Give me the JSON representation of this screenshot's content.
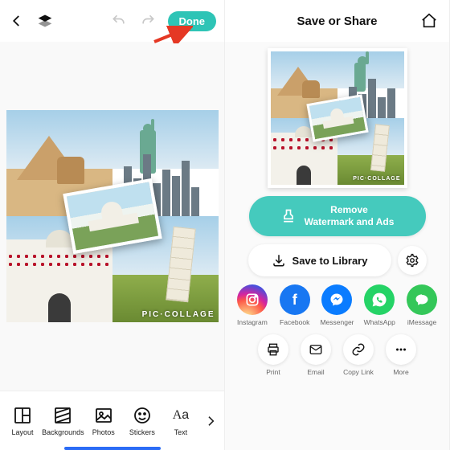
{
  "left": {
    "done_label": "Done",
    "watermark": "PIC·COLLAGE",
    "toolbar": [
      {
        "id": "layout",
        "label": "Layout"
      },
      {
        "id": "backgrounds",
        "label": "Backgrounds"
      },
      {
        "id": "photos",
        "label": "Photos"
      },
      {
        "id": "stickers",
        "label": "Stickers"
      },
      {
        "id": "text",
        "label": "Text"
      }
    ]
  },
  "right": {
    "title": "Save or Share",
    "remove_line1": "Remove",
    "remove_line2": "Watermark and Ads",
    "save_label": "Save to Library",
    "watermark": "PIC·COLLAGE",
    "share": [
      {
        "id": "instagram",
        "label": "Instagram"
      },
      {
        "id": "facebook",
        "label": "Facebook"
      },
      {
        "id": "messenger",
        "label": "Messenger"
      },
      {
        "id": "whatsapp",
        "label": "WhatsApp"
      },
      {
        "id": "imessage",
        "label": "iMessage"
      }
    ],
    "actions": [
      {
        "id": "print",
        "label": "Print"
      },
      {
        "id": "email",
        "label": "Email"
      },
      {
        "id": "copylink",
        "label": "Copy Link"
      },
      {
        "id": "more",
        "label": "More"
      }
    ]
  },
  "colors": {
    "accent": "#2ec4b6"
  }
}
